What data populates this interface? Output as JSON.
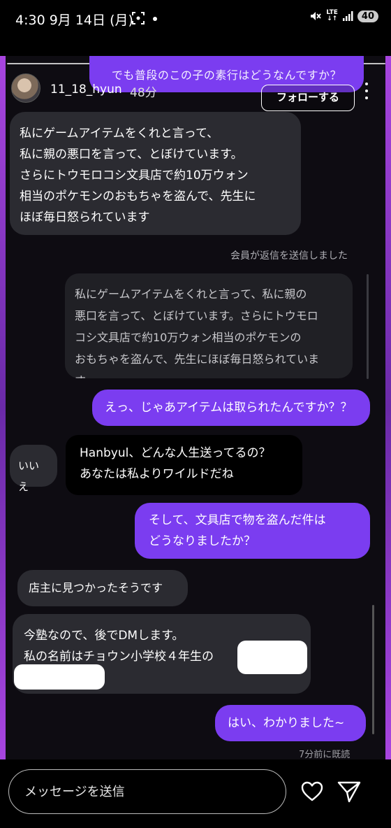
{
  "status_bar": {
    "time": "4:30",
    "date": "9月 14日 (月)",
    "network": "LTE",
    "battery": "40"
  },
  "story": {
    "top_question": "でも普段のこの子の素行はどうなんですか？",
    "username": "11_18_hyun",
    "posted_ago": "48分",
    "follow_label": "フォローする"
  },
  "messages": {
    "msg1": [
      "私にゲームアイテムをくれと言って、",
      "私に親の悪口を言って、とぼけています。",
      "さらにトウモロコシ文具店で約10万ウォン",
      "相当のポケモンのおもちゃを盗んで、先生に",
      "ほぼ毎日怒られています"
    ],
    "reply_notice": "会員が返信を送信しました",
    "quoted": [
      "私にゲームアイテムをくれと言って、私に親の",
      "悪口を言って、とぼけています。さらにトウモロ",
      "コシ文具店で約10万ウォン相当のポケモンの",
      "おもちゃを盗んで、先生にほぼ毎日怒られていま す..."
    ],
    "msg2": "えっ、じゃあアイテムは取られたんですか？？",
    "msg3": "いいえ",
    "msg4": [
      "Hanbyul、どんな人生送ってるの？",
      "あなたは私よりワイルドだね"
    ],
    "msg5": [
      "そして、文具店で物を盗んだ件は",
      "どうなりましたか？"
    ],
    "msg6": "店主に見つかったそうです",
    "msg7": [
      "今塾なので、後でDMします。",
      "私の名前はチョウン小学校４年生の"
    ],
    "msg8": "はい、わかりました~",
    "seen": "7分前に既読"
  },
  "input": {
    "placeholder": "メッセージを送信"
  },
  "icons": {
    "like": "heart-icon",
    "send": "send-icon",
    "more": "more-icon"
  },
  "colors": {
    "accent_purple": "#7b3df0",
    "bubble_dark": "#2b2b31",
    "background": "#0e0c12"
  }
}
